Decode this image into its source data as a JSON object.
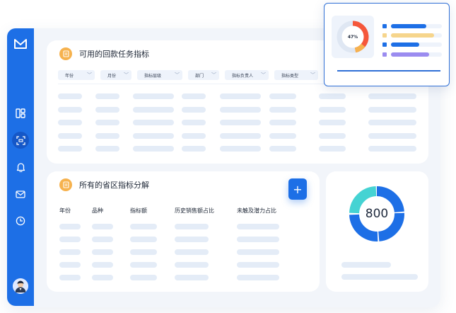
{
  "colors": {
    "primary": "#1d6fe6",
    "teal": "#45d3d3",
    "orange": "#f6b24e",
    "skeleton": "#e4ecf7",
    "legend": [
      "#1d6fe6",
      "#f6d58c",
      "#1d6fe6",
      "#9b8cf0"
    ]
  },
  "sidebar": {
    "icons": [
      "logo-icon",
      "dashboard-icon",
      "scan-icon",
      "bell-icon",
      "mail-icon",
      "clock-icon",
      "avatar"
    ]
  },
  "top_card": {
    "title": "可用的回款任务指标",
    "filters": [
      "年份",
      "月份",
      "指标层级",
      "部门",
      "指标负责人",
      "指标类型"
    ]
  },
  "region_card": {
    "title": "所有的省区指标分解",
    "add_label": "+",
    "columns": [
      "年份",
      "品种",
      "指标额",
      "历史销售额占比",
      "未触及潜力占比"
    ]
  },
  "donut_card": {
    "value": "800"
  },
  "popup": {
    "percent_label": "47%",
    "percent": 0.47,
    "legend_fills": [
      0.7,
      0.85,
      0.55,
      0.75
    ]
  }
}
